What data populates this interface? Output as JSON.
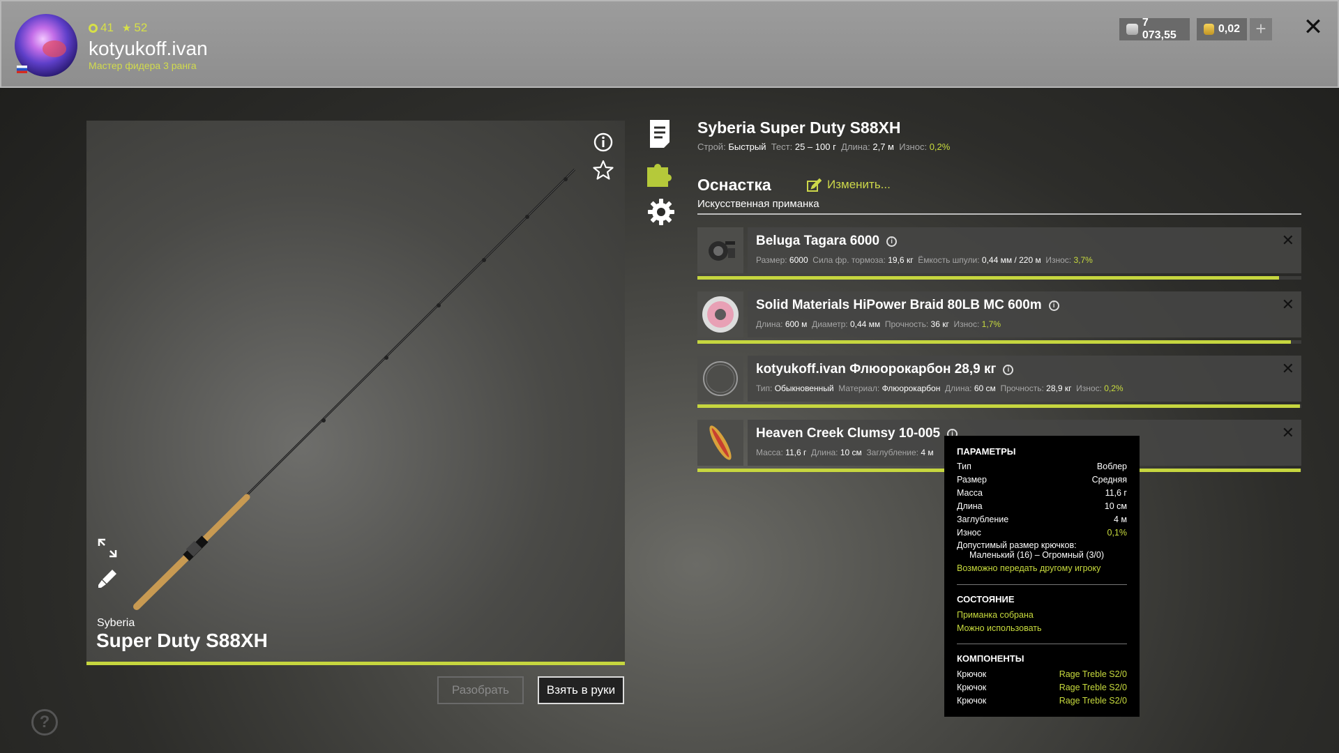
{
  "player": {
    "level": "41",
    "rating": "52",
    "username": "kotyukoff.ivan",
    "rank": "Мастер фидера 3 ранга"
  },
  "currency": {
    "silver": "7 073,55",
    "gold": "0,02",
    "add_label": "+"
  },
  "close_label": "✕",
  "rod": {
    "brand": "Syberia",
    "model": "Super Duty S88XH",
    "full_name": "Syberia Super Duty S88XH",
    "specs": {
      "action_label": "Строй:",
      "action": "Быстрый",
      "test_label": "Тест:",
      "test": "25 – 100 г",
      "length_label": "Длина:",
      "length": "2,7 м",
      "wear_label": "Износ:",
      "wear": "0,2%"
    },
    "accent_color": "#c6d63f"
  },
  "buttons": {
    "disassemble": "Разобрать",
    "equip": "Взять в руки",
    "help": "?"
  },
  "rig": {
    "title": "Оснастка",
    "edit": "Изменить...",
    "subtitle": "Искусственная приманка"
  },
  "components": [
    {
      "name": "Beluga Tagara 6000",
      "icon": "reel-thumbnail",
      "details": [
        {
          "label": "Размер:",
          "value": "6000"
        },
        {
          "label": "Сила фр. тормоза:",
          "value": "19,6 кг"
        },
        {
          "label": "Ёмкость шпули:",
          "value": "0,44 мм / 220 м"
        },
        {
          "label": "Износ:",
          "value": "3,7%",
          "wear": true
        }
      ],
      "condition": 0.963
    },
    {
      "name": "Solid Materials HiPower Braid 80LB MC 600m",
      "icon": "line-spool-thumbnail",
      "details": [
        {
          "label": "Длина:",
          "value": "600 м"
        },
        {
          "label": "Диаметр:",
          "value": "0,44 мм"
        },
        {
          "label": "Прочность:",
          "value": "36 кг"
        },
        {
          "label": "Износ:",
          "value": "1,7%",
          "wear": true
        }
      ],
      "condition": 0.983
    },
    {
      "name": "kotyukoff.ivan Флюорокарбон 28,9 кг",
      "icon": "leader-coil-thumbnail",
      "details": [
        {
          "label": "Тип:",
          "value": "Обыкновенный"
        },
        {
          "label": "Материал:",
          "value": "Флюорокарбон"
        },
        {
          "label": "Длина:",
          "value": "60 см"
        },
        {
          "label": "Прочность:",
          "value": "28,9 кг"
        },
        {
          "label": "Износ:",
          "value": "0,2%",
          "wear": true
        }
      ],
      "condition": 0.998
    },
    {
      "name": "Heaven Creek Clumsy 10-005",
      "icon": "wobbler-thumbnail",
      "details": [
        {
          "label": "Масса:",
          "value": "11,6 г"
        },
        {
          "label": "Длина:",
          "value": "10 см"
        },
        {
          "label": "Заглубление:",
          "value": "4 м"
        }
      ],
      "condition": 0.999
    }
  ],
  "tooltip": {
    "params_title": "ПАРАМЕТРЫ",
    "params": [
      {
        "label": "Тип",
        "value": "Воблер"
      },
      {
        "label": "Размер",
        "value": "Средняя"
      },
      {
        "label": "Масса",
        "value": "11,6 г"
      },
      {
        "label": "Длина",
        "value": "10 см"
      },
      {
        "label": "Заглубление",
        "value": "4 м"
      },
      {
        "label": "Износ",
        "value": "0,1%"
      }
    ],
    "hook_size_label": "Допустимый размер крючков:",
    "hook_size_value": "Маленький (16) – Огромный (3/0)",
    "transferable": "Возможно передать другому игроку",
    "state_title": "СОСТОЯНИЕ",
    "state_1": "Приманка собрана",
    "state_2": "Можно использовать",
    "components_title": "КОМПОНЕНТЫ",
    "components": [
      {
        "label": "Крючок",
        "value": "Rage Treble S2/0"
      },
      {
        "label": "Крючок",
        "value": "Rage Treble S2/0"
      },
      {
        "label": "Крючок",
        "value": "Rage Treble S2/0"
      }
    ]
  }
}
